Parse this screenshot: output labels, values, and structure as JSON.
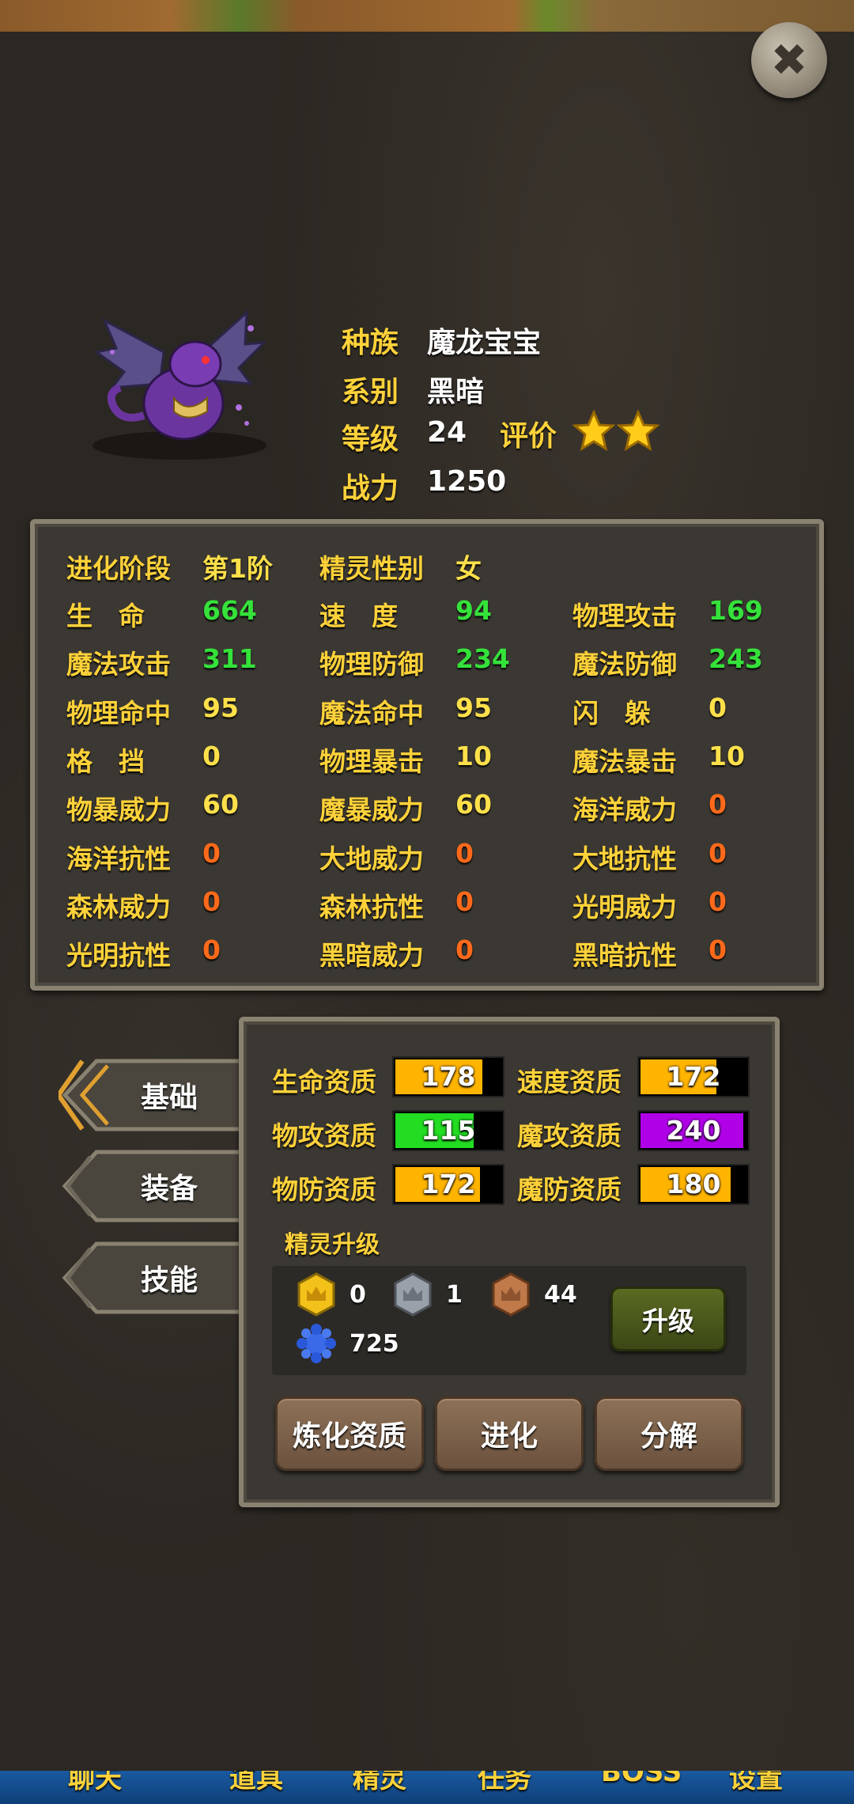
{
  "info": {
    "race_label": "种族",
    "race_value": "魔龙宝宝",
    "element_label": "系别",
    "element_value": "黑暗",
    "level_label": "等级",
    "level_value": "24",
    "rating_label": "评价",
    "rating_stars": 2,
    "power_label": "战力",
    "power_value": "1250"
  },
  "stats": {
    "evo_label": "进化阶段",
    "evo_value": "第1阶",
    "gender_label": "精灵性别",
    "gender_value": "女",
    "rows": [
      [
        {
          "k": "生　命",
          "v": "664",
          "c": "green"
        },
        {
          "k": "速　度",
          "v": "94",
          "c": "green"
        },
        {
          "k": "物理攻击",
          "v": "169",
          "c": "green"
        }
      ],
      [
        {
          "k": "魔法攻击",
          "v": "311",
          "c": "green"
        },
        {
          "k": "物理防御",
          "v": "234",
          "c": "green"
        },
        {
          "k": "魔法防御",
          "v": "243",
          "c": "green"
        }
      ],
      [
        {
          "k": "物理命中",
          "v": "95",
          "c": "yellow"
        },
        {
          "k": "魔法命中",
          "v": "95",
          "c": "yellow"
        },
        {
          "k": "闪　躲",
          "v": "0",
          "c": "yellow"
        }
      ],
      [
        {
          "k": "格　挡",
          "v": "0",
          "c": "yellow"
        },
        {
          "k": "物理暴击",
          "v": "10",
          "c": "yellow"
        },
        {
          "k": "魔法暴击",
          "v": "10",
          "c": "yellow"
        }
      ],
      [
        {
          "k": "物暴威力",
          "v": "60",
          "c": "yellow"
        },
        {
          "k": "魔暴威力",
          "v": "60",
          "c": "yellow"
        },
        {
          "k": "海洋威力",
          "v": "0",
          "c": "orange"
        }
      ],
      [
        {
          "k": "海洋抗性",
          "v": "0",
          "c": "orange"
        },
        {
          "k": "大地威力",
          "v": "0",
          "c": "orange"
        },
        {
          "k": "大地抗性",
          "v": "0",
          "c": "orange"
        }
      ],
      [
        {
          "k": "森林威力",
          "v": "0",
          "c": "orange"
        },
        {
          "k": "森林抗性",
          "v": "0",
          "c": "orange"
        },
        {
          "k": "光明威力",
          "v": "0",
          "c": "orange"
        }
      ],
      [
        {
          "k": "光明抗性",
          "v": "0",
          "c": "orange"
        },
        {
          "k": "黑暗威力",
          "v": "0",
          "c": "orange"
        },
        {
          "k": "黑暗抗性",
          "v": "0",
          "c": "orange"
        }
      ]
    ]
  },
  "tabs": {
    "basic": "基础",
    "equip": "装备",
    "skill": "技能"
  },
  "aptitude": [
    {
      "k": "生命资质",
      "v": "178",
      "fill": 0.82,
      "color": "#ffb400"
    },
    {
      "k": "速度资质",
      "v": "172",
      "fill": 0.72,
      "color": "#ffb400"
    },
    {
      "k": "物攻资质",
      "v": "115",
      "fill": 0.74,
      "color": "#22dd22"
    },
    {
      "k": "魔攻资质",
      "v": "240",
      "fill": 0.97,
      "color": "#b000e8"
    },
    {
      "k": "物防资质",
      "v": "172",
      "fill": 0.8,
      "color": "#ffb400"
    },
    {
      "k": "魔防资质",
      "v": "180",
      "fill": 0.85,
      "color": "#ffb400"
    }
  ],
  "upgrade": {
    "title": "精灵升级",
    "gold": "0",
    "silver": "1",
    "bronze": "44",
    "crystal": "725",
    "button": "升级"
  },
  "actions": {
    "refine": "炼化资质",
    "evolve": "进化",
    "decompose": "分解"
  },
  "nav": [
    "聊天",
    "道具",
    "精灵",
    "任务",
    "BOSS",
    "设置"
  ]
}
